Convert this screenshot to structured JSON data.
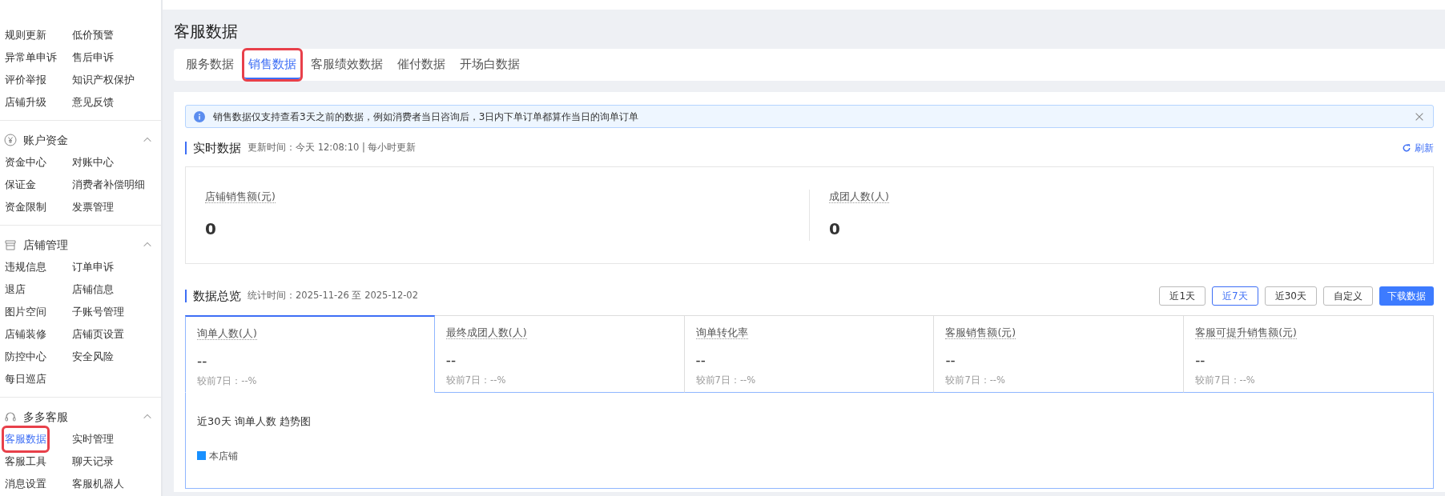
{
  "sidebar": {
    "sections": [
      {
        "items": [
          {
            "label": "规则更新",
            "selected": false,
            "annotated": false
          },
          {
            "label": "低价预警",
            "selected": false,
            "annotated": false
          },
          {
            "label": "异常单申诉",
            "selected": false,
            "annotated": false
          },
          {
            "label": "售后申诉",
            "selected": false,
            "annotated": false
          },
          {
            "label": "评价举报",
            "selected": false,
            "annotated": false
          },
          {
            "label": "知识产权保护",
            "selected": false,
            "annotated": false
          },
          {
            "label": "店铺升级",
            "selected": false,
            "annotated": false
          },
          {
            "label": "意见反馈",
            "selected": false,
            "annotated": false
          }
        ]
      },
      {
        "title": "账户资金",
        "expanded": true,
        "items": [
          {
            "label": "资金中心",
            "selected": false,
            "annotated": false
          },
          {
            "label": "对账中心",
            "selected": false,
            "annotated": false
          },
          {
            "label": "保证金",
            "selected": false,
            "annotated": false
          },
          {
            "label": "消费者补偿明细",
            "selected": false,
            "annotated": false
          },
          {
            "label": "资金限制",
            "selected": false,
            "annotated": false
          },
          {
            "label": "发票管理",
            "selected": false,
            "annotated": false
          }
        ]
      },
      {
        "title": "店铺管理",
        "expanded": true,
        "items": [
          {
            "label": "违规信息",
            "selected": false,
            "annotated": false
          },
          {
            "label": "订单申诉",
            "selected": false,
            "annotated": false
          },
          {
            "label": "退店",
            "selected": false,
            "annotated": false
          },
          {
            "label": "店铺信息",
            "selected": false,
            "annotated": false
          },
          {
            "label": "图片空间",
            "selected": false,
            "annotated": false
          },
          {
            "label": "子账号管理",
            "selected": false,
            "annotated": false
          },
          {
            "label": "店铺装修",
            "selected": false,
            "annotated": false
          },
          {
            "label": "店铺页设置",
            "selected": false,
            "annotated": false
          },
          {
            "label": "防控中心",
            "selected": false,
            "annotated": false
          },
          {
            "label": "安全风险",
            "selected": false,
            "annotated": false
          },
          {
            "label": "每日巡店",
            "selected": false,
            "annotated": false
          }
        ]
      },
      {
        "title": "多多客服",
        "expanded": true,
        "items": [
          {
            "label": "客服数据",
            "selected": true,
            "annotated": true
          },
          {
            "label": "实时管理",
            "selected": false,
            "annotated": false
          },
          {
            "label": "客服工具",
            "selected": false,
            "annotated": false
          },
          {
            "label": "聊天记录",
            "selected": false,
            "annotated": false
          },
          {
            "label": "消息设置",
            "selected": false,
            "annotated": false
          },
          {
            "label": "客服机器人",
            "selected": false,
            "annotated": false
          }
        ]
      }
    ]
  },
  "page_title": "客服数据",
  "tabs": [
    {
      "label": "服务数据",
      "selected": false,
      "annotated": false
    },
    {
      "label": "销售数据",
      "selected": true,
      "annotated": true
    },
    {
      "label": "客服绩效数据",
      "selected": false,
      "annotated": false
    },
    {
      "label": "催付数据",
      "selected": false,
      "annotated": false
    },
    {
      "label": "开场白数据",
      "selected": false,
      "annotated": false
    }
  ],
  "notice": "销售数据仅支持查看3天之前的数据，例如消费者当日咨询后，3日内下单订单都算作当日的询单订单",
  "realtime": {
    "title": "实时数据",
    "subtitle": "更新时间：今天 12:08:10 | 每小时更新",
    "refresh": "刷新",
    "metrics": [
      {
        "label": "店铺销售额(元)",
        "value": "0"
      },
      {
        "label": "成团人数(人)",
        "value": "0"
      }
    ]
  },
  "overview": {
    "title": "数据总览",
    "subtitle": "统计时间：2025-11-26 至 2025-12-02",
    "ranges": [
      {
        "label": "近1天",
        "selected": false
      },
      {
        "label": "近7天",
        "selected": true
      },
      {
        "label": "近30天",
        "selected": false
      },
      {
        "label": "自定义",
        "selected": false
      }
    ],
    "download": "下载数据",
    "metrics": [
      {
        "label": "询单人数(人)",
        "value": "--",
        "compare": "较前7日：--%",
        "selected": true
      },
      {
        "label": "最终成团人数(人)",
        "value": "--",
        "compare": "较前7日：--%",
        "selected": false
      },
      {
        "label": "询单转化率",
        "value": "--",
        "compare": "较前7日：--%",
        "selected": false
      },
      {
        "label": "客服销售额(元)",
        "value": "--",
        "compare": "较前7日：--%",
        "selected": false
      },
      {
        "label": "客服可提升销售额(元)",
        "value": "--",
        "compare": "较前7日：--%",
        "selected": false
      }
    ],
    "trend": {
      "title": "近30天 询单人数 趋势图",
      "legend": [
        {
          "label": "本店铺",
          "color": "#1890ff"
        }
      ]
    }
  }
}
